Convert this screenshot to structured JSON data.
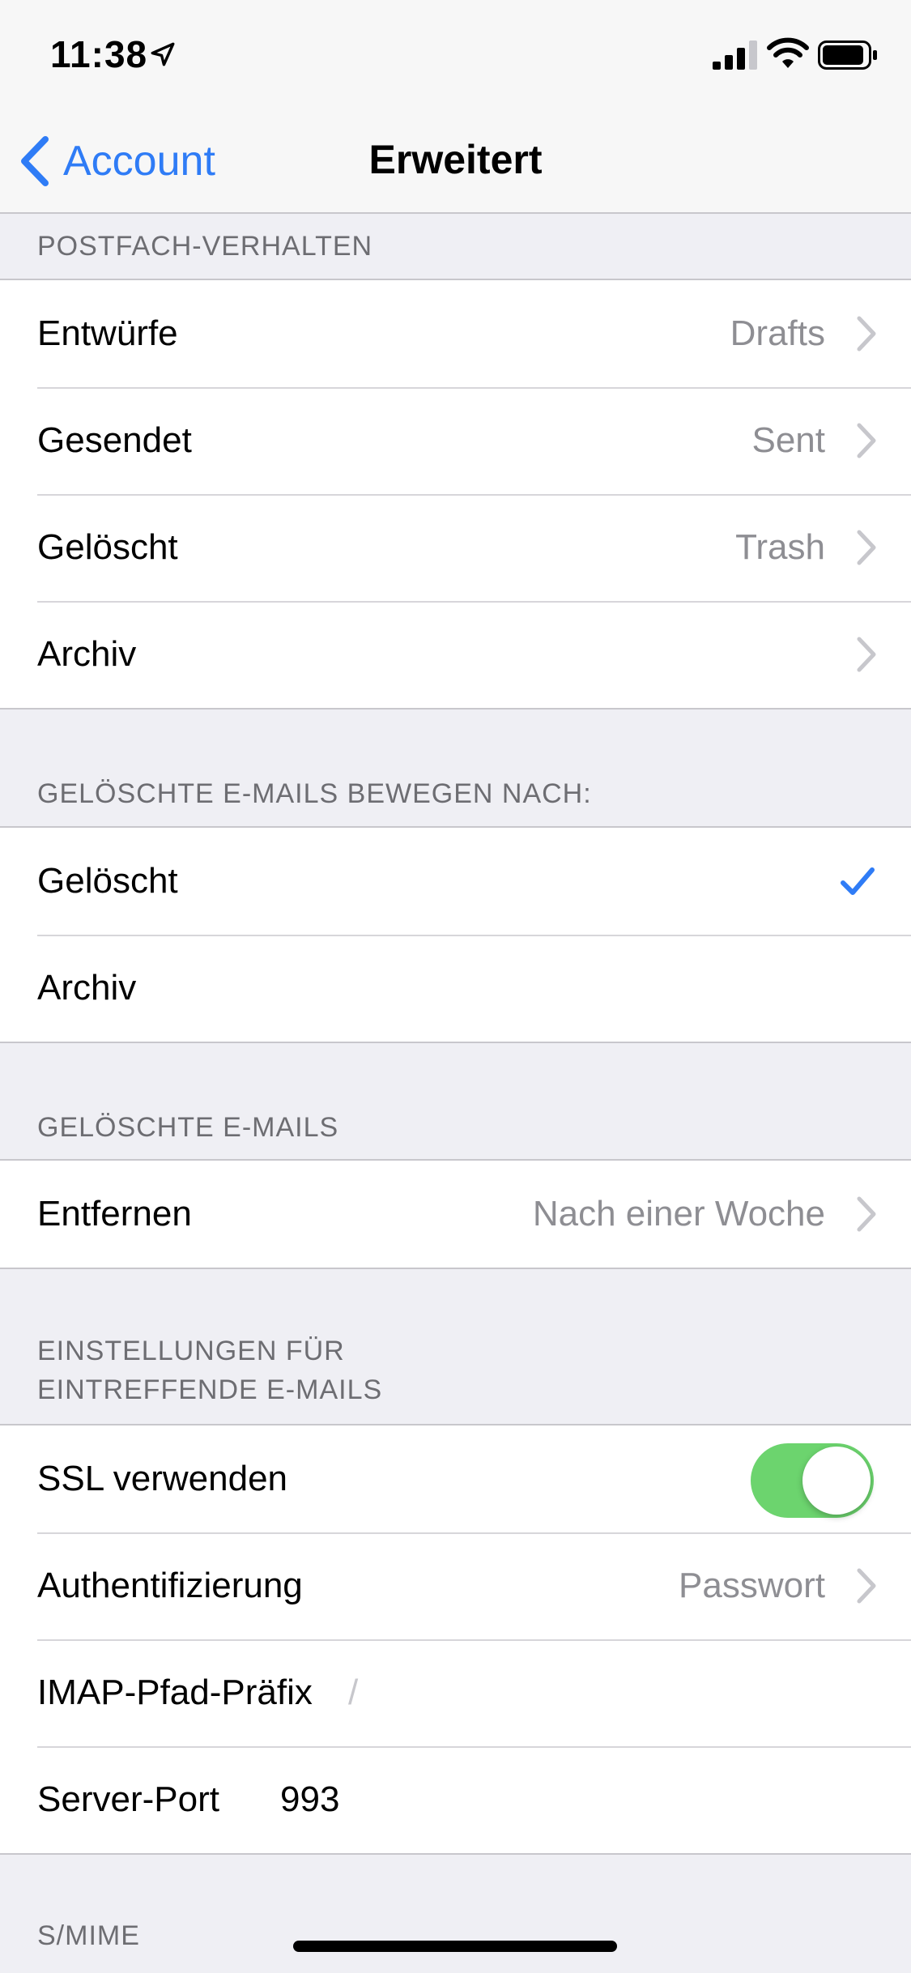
{
  "status": {
    "time": "11:38"
  },
  "nav": {
    "back_label": "Account",
    "title": "Erweitert"
  },
  "sections": {
    "mailbox_behavior": {
      "header": "POSTFACH-VERHALTEN",
      "rows": [
        {
          "label": "Entwürfe",
          "value": "Drafts"
        },
        {
          "label": "Gesendet",
          "value": "Sent"
        },
        {
          "label": "Gelöscht",
          "value": "Trash"
        },
        {
          "label": "Archiv",
          "value": ""
        }
      ]
    },
    "move_deleted": {
      "header": "GELÖSCHTE E-MAILS BEWEGEN NACH:",
      "rows": [
        {
          "label": "Gelöscht",
          "checked": true
        },
        {
          "label": "Archiv",
          "checked": false
        }
      ]
    },
    "deleted_mails": {
      "header": "GELÖSCHTE E-MAILS",
      "rows": [
        {
          "label": "Entfernen",
          "value": "Nach einer Woche"
        }
      ]
    },
    "incoming": {
      "header_line1": "EINSTELLUNGEN FÜR",
      "header_line2": "EINTREFFENDE E-MAILS",
      "ssl": {
        "label": "SSL verwenden",
        "on": true
      },
      "auth": {
        "label": "Authentifizierung",
        "value": "Passwort"
      },
      "imap_prefix": {
        "label": "IMAP-Pfad-Präfix",
        "value": "/"
      },
      "server_port": {
        "label": "Server-Port",
        "value": "993"
      }
    },
    "smime": {
      "header": "S/MIME"
    }
  },
  "colors": {
    "accent": "#2f7cf6",
    "toggle_on": "#6cd46e",
    "background": "#efeff4"
  }
}
